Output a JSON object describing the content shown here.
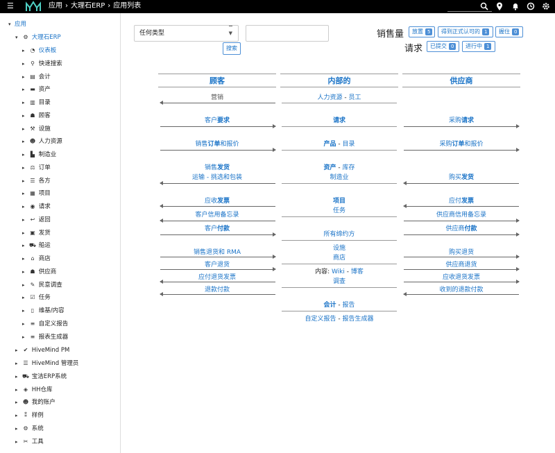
{
  "topbar": {
    "breadcrumb": [
      "应用",
      "大理石ERP",
      "应用列表"
    ],
    "icons": [
      "search-icon",
      "map-marker-icon",
      "bell-icon",
      "history-icon",
      "gear-icon"
    ]
  },
  "sidebar": {
    "root": "应用",
    "app": "大理石ERP",
    "items": [
      {
        "label": "仪表板",
        "icon": "dashboard-icon"
      },
      {
        "label": "快速搜索",
        "icon": "search-icon"
      },
      {
        "label": "会计",
        "icon": "accounting-icon"
      },
      {
        "label": "资产",
        "icon": "assets-icon"
      },
      {
        "label": "目录",
        "icon": "catalog-icon"
      },
      {
        "label": "顾客",
        "icon": "customer-icon"
      },
      {
        "label": "设施",
        "icon": "facility-icon"
      },
      {
        "label": "人力资源",
        "icon": "hr-icon"
      },
      {
        "label": "制造业",
        "icon": "factory-icon"
      },
      {
        "label": "订单",
        "icon": "order-icon"
      },
      {
        "label": "各方",
        "icon": "parties-icon"
      },
      {
        "label": "项目",
        "icon": "project-icon"
      },
      {
        "label": "请求",
        "icon": "request-icon"
      },
      {
        "label": "返回",
        "icon": "return-icon"
      },
      {
        "label": "发货",
        "icon": "shipment-icon"
      },
      {
        "label": "船运",
        "icon": "shipping-icon"
      },
      {
        "label": "商店",
        "icon": "store-icon"
      },
      {
        "label": "供应商",
        "icon": "supplier-icon"
      },
      {
        "label": "民意调查",
        "icon": "survey-icon"
      },
      {
        "label": "任务",
        "icon": "task-icon"
      },
      {
        "label": "维基/内容",
        "icon": "wiki-icon"
      },
      {
        "label": "自定义报告",
        "icon": "database-icon"
      },
      {
        "label": "报表生成器",
        "icon": "database-icon"
      }
    ],
    "other_apps": [
      {
        "label": "HiveMind PM",
        "icon": "check-icon"
      },
      {
        "label": "HiveMind 管理员",
        "icon": "list-icon"
      },
      {
        "label": "宝洁ERP系统",
        "icon": "cart-icon"
      },
      {
        "label": "HH仓库",
        "icon": "tags-icon"
      },
      {
        "label": "我的账户",
        "icon": "user-icon"
      },
      {
        "label": "样例",
        "icon": "code-icon"
      },
      {
        "label": "系统",
        "icon": "gear-icon"
      },
      {
        "label": "工具",
        "icon": "wrench-icon"
      }
    ]
  },
  "filters": {
    "type_select": "任何类型",
    "search_button": "搜索"
  },
  "sales": {
    "label": "销售量",
    "buttons": [
      {
        "label": "放置",
        "count": "5"
      },
      {
        "label": "得到正式认可的",
        "count": "1"
      },
      {
        "label": "握住",
        "count": "0"
      }
    ]
  },
  "requests": {
    "label": "请求",
    "buttons": [
      {
        "label": "已提交",
        "count": "0"
      },
      {
        "label": "进行中",
        "count": "1"
      }
    ]
  },
  "flow": {
    "headers": [
      "顾客",
      "内部的",
      "供应商"
    ],
    "customer": {
      "marketing": "营销",
      "cust_request_a": "客户",
      "cust_request_b": "要求",
      "sales_order_a": "销售",
      "sales_order_b": "订单",
      "sales_order_c": "和报价",
      "sales_shipment_a": "销售",
      "sales_shipment_b": "发货",
      "ship_pick": "运输 - 挑选和包装",
      "ar_invoice_a": "应收",
      "ar_invoice_b": "发票",
      "credit_memo": "客户信用备忘录",
      "cust_payment_a": "客户",
      "cust_payment_b": "付款",
      "sales_return": "销售退货和 RMA",
      "cust_return": "客户退货",
      "ap_return_invoice": "应付退货发票",
      "refund_payment": "退款付款"
    },
    "internal": {
      "hr": "人力资源",
      "dash": " - ",
      "employee": "员工",
      "request": "请求",
      "product": "产品",
      "catalog": "目录",
      "assets": "资产",
      "inventory": "库存",
      "manufacturing": "制造业",
      "project": "项目",
      "task": "任务",
      "agreements": "所有缔约方",
      "facility": "设施",
      "store": "商店",
      "content_label": "内容: ",
      "wiki": "Wiki",
      "blog": "博客",
      "survey": "调查",
      "accounting": "会计",
      "report": "报告",
      "custom_report": "自定义报告",
      "report_builder": "报告生成器"
    },
    "supplier": {
      "purchase_request_a": "采购",
      "purchase_request_b": "请求",
      "purchase_order_a": "采购",
      "purchase_order_b": "订单",
      "purchase_order_c": "和报价",
      "purchase_shipment_a": "购买",
      "purchase_shipment_b": "发货",
      "ap_invoice_a": "应付",
      "ap_invoice_b": "发票",
      "supplier_credit_memo": "供应商信用备忘录",
      "supplier_payment_a": "供应商",
      "supplier_payment_b": "付款",
      "purchase_return": "购买退货",
      "supplier_return": "供应商退货",
      "ar_return_invoice": "应收退货发票",
      "refund_received": "收到的退款付款"
    }
  }
}
